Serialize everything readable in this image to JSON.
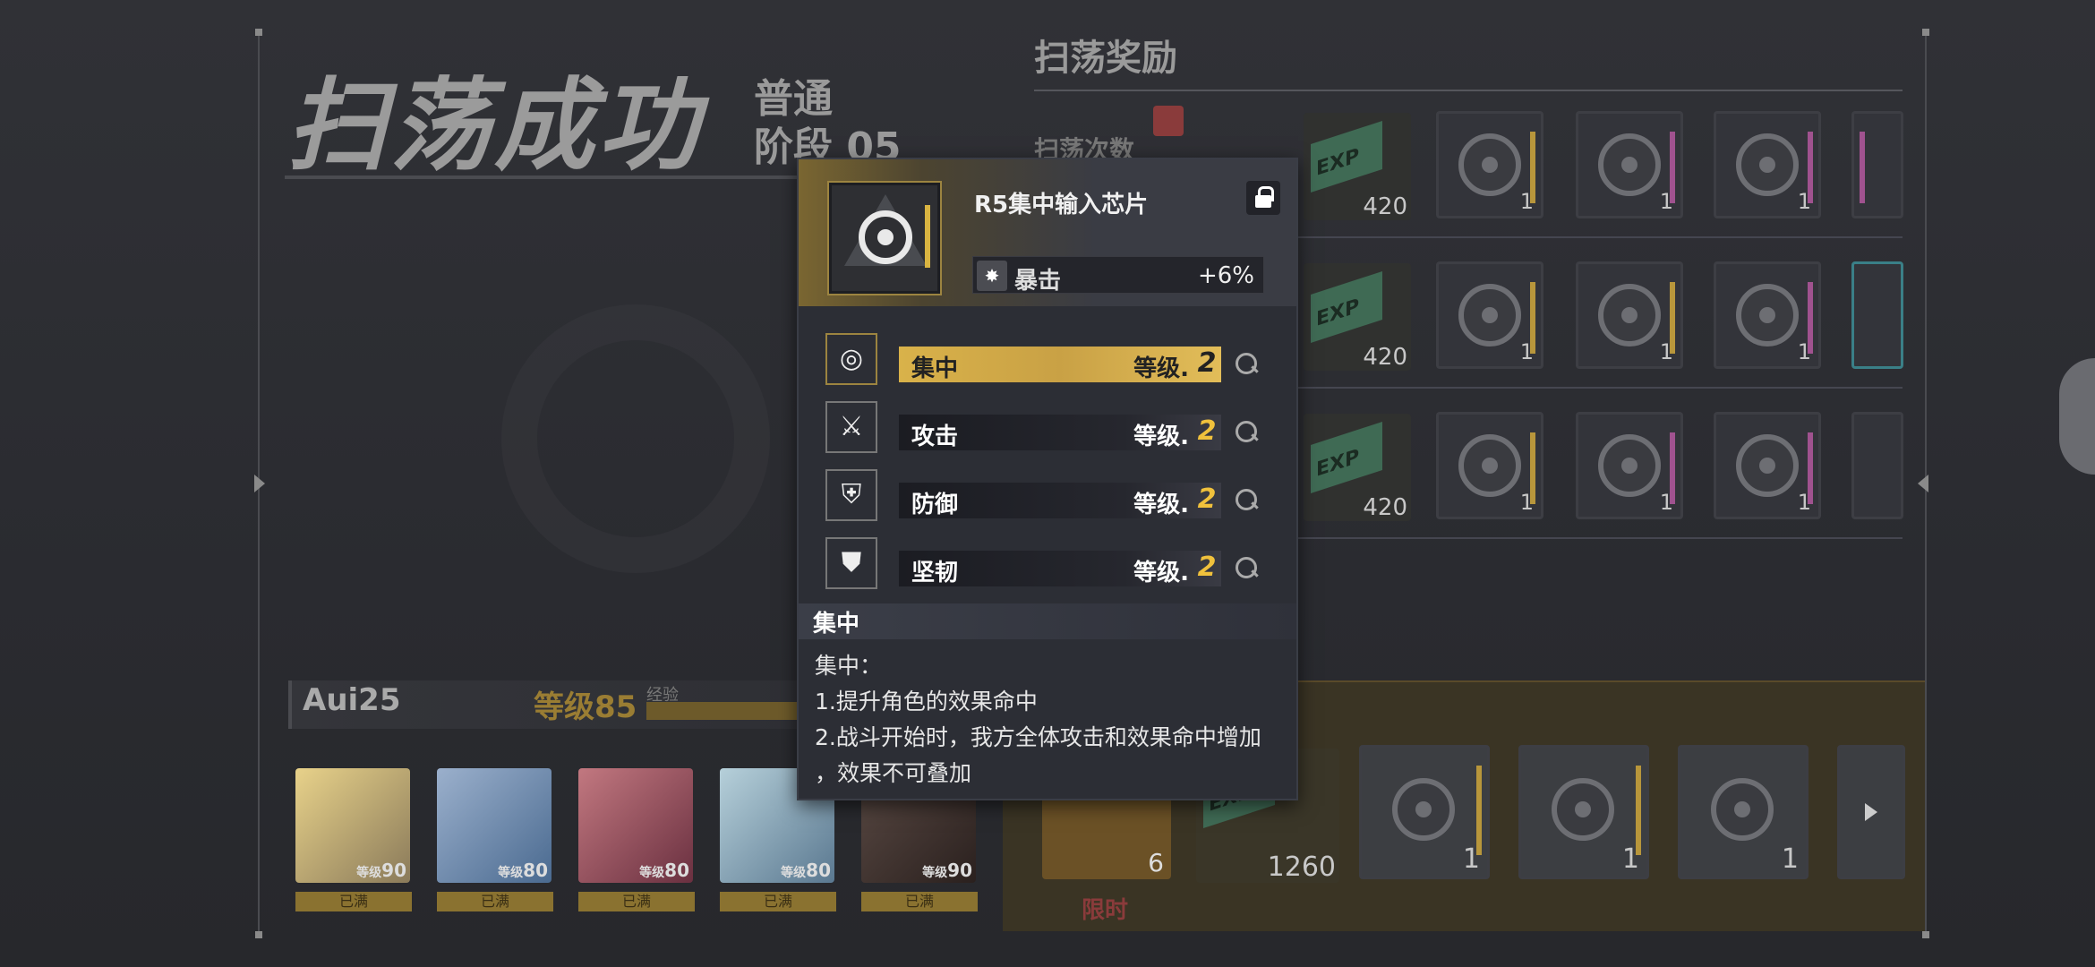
{
  "header": {
    "title": "扫荡成功",
    "difficulty": "普通",
    "stage": "阶段 05"
  },
  "rewards": {
    "section_title": "扫荡奖励",
    "row_label": "扫荡次数",
    "rows": [
      {
        "exp": "420",
        "items": [
          "1",
          "1",
          "1"
        ]
      },
      {
        "exp": "420",
        "items": [
          "1",
          "1",
          "1"
        ]
      },
      {
        "exp": "420",
        "items": [
          "1",
          "1",
          "1"
        ]
      }
    ],
    "exp_tag": "EXP"
  },
  "player": {
    "name": "Aui25",
    "level": "等级85",
    "exp_label": "经验"
  },
  "team": [
    {
      "level_prefix": "等级",
      "level": "90",
      "badge": "已满",
      "color": "#d8b862"
    },
    {
      "level_prefix": "等级",
      "level": "80",
      "badge": "已满",
      "color": "#6c8fb5"
    },
    {
      "level_prefix": "等级",
      "level": "80",
      "badge": "已满",
      "color": "#a4545e"
    },
    {
      "level_prefix": "等级",
      "level": "80",
      "badge": "已满",
      "color": "#7fa4b6"
    },
    {
      "level_prefix": "等级",
      "level": "90",
      "badge": "已满",
      "color": "#4a3a36"
    }
  ],
  "bottom_rewards": {
    "count1": "6",
    "exp": "1260",
    "items": [
      "1",
      "1",
      "1"
    ],
    "limited": "限时"
  },
  "popup": {
    "item_name": "R5集中输入芯片",
    "main_stat": {
      "name": "暴击",
      "value": "+6%"
    },
    "skills": [
      {
        "name": "集中",
        "level_label": "等级.",
        "level": "2",
        "icon": "concentration-icon",
        "active": true
      },
      {
        "name": "攻击",
        "level_label": "等级.",
        "level": "2",
        "icon": "attack-icon",
        "active": false
      },
      {
        "name": "防御",
        "level_label": "等级.",
        "level": "2",
        "icon": "defense-icon",
        "active": false
      },
      {
        "name": "坚韧",
        "level_label": "等级.",
        "level": "2",
        "icon": "tenacity-icon",
        "active": false
      }
    ],
    "desc_title": "集中",
    "desc_lines": [
      "集中：",
      "1.提升角色的效果命中",
      "2.战斗开始时，我方全体攻击和效果命中增加",
      "，效果不可叠加"
    ]
  },
  "colors": {
    "gold": "#d9b24a",
    "purple_stripe": "#a0528f",
    "gold_stripe": "#b8963b"
  }
}
